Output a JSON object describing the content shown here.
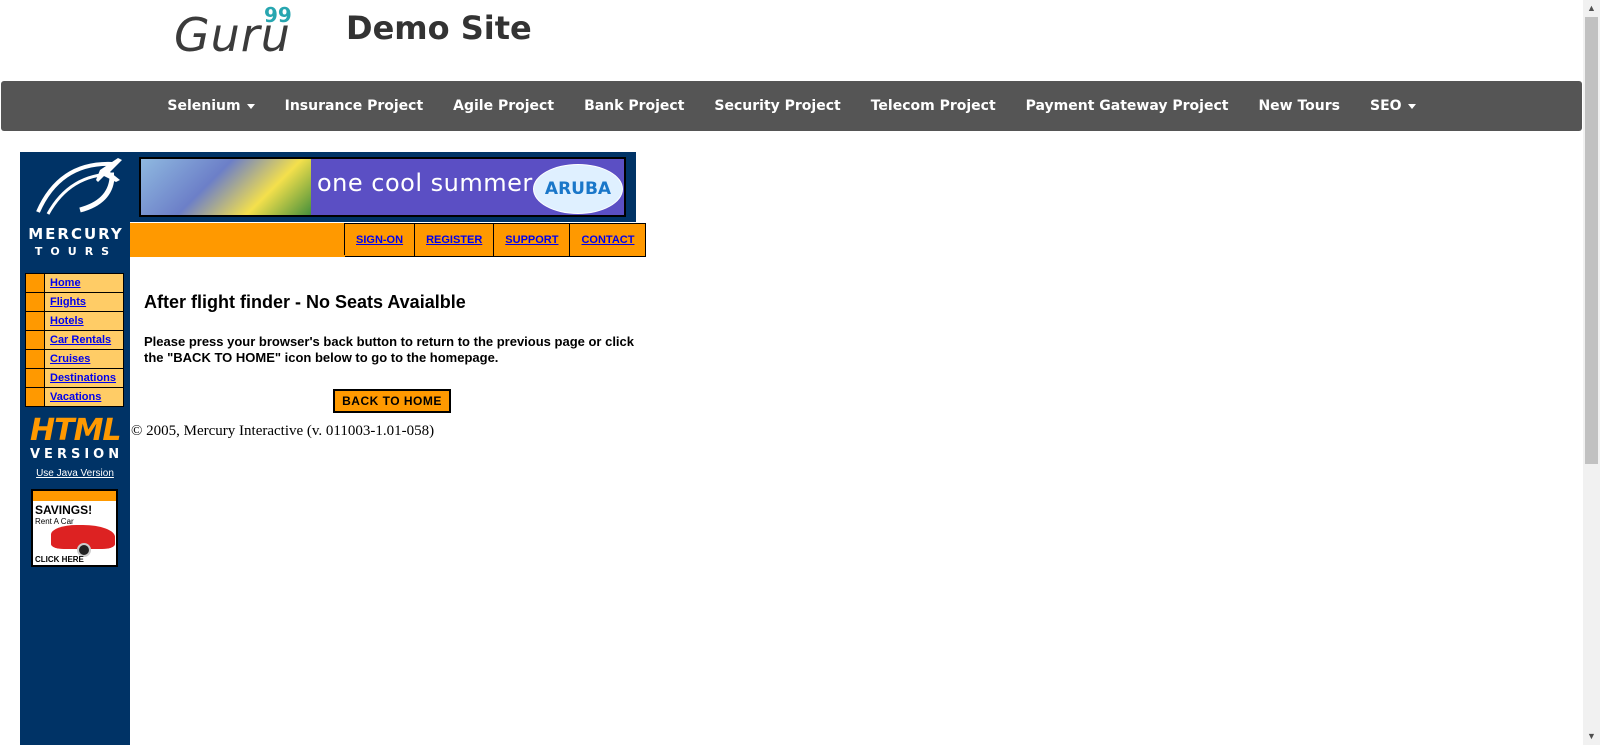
{
  "header": {
    "logo": "Guru",
    "logo_superscript": "99",
    "site_title": "Demo Site"
  },
  "navbar": {
    "items": [
      {
        "label": "Selenium",
        "dropdown": true
      },
      {
        "label": "Insurance Project",
        "dropdown": false
      },
      {
        "label": "Agile Project",
        "dropdown": false
      },
      {
        "label": "Bank Project",
        "dropdown": false
      },
      {
        "label": "Security Project",
        "dropdown": false
      },
      {
        "label": "Telecom Project",
        "dropdown": false
      },
      {
        "label": "Payment Gateway Project",
        "dropdown": false
      },
      {
        "label": "New Tours",
        "dropdown": false
      },
      {
        "label": "SEO",
        "dropdown": true
      }
    ]
  },
  "mercury": {
    "logo_line1": "MERCURY",
    "logo_line2": "TOURS",
    "banner_text": "one cool summer",
    "banner_brand": "ARUBA",
    "top_links": [
      "SIGN-ON",
      "REGISTER",
      "SUPPORT",
      "CONTACT"
    ],
    "left_nav": [
      "Home",
      "Flights",
      "Hotels",
      "Car Rentals",
      "Cruises",
      "Destinations",
      "Vacations"
    ],
    "html_version_big": "HTML",
    "html_version_small": "VERSION",
    "java_link": "Use Java Version",
    "ad": {
      "title": "SAVINGS!",
      "subtitle": "Rent A Car",
      "cta": "CLICK HERE"
    }
  },
  "main": {
    "heading": "After flight finder - No Seats Avaialble",
    "message": "Please press your browser's back button to return to the previous page or click the \"BACK TO HOME\" icon below to go to the homepage.",
    "back_button": "BACK TO HOME",
    "copyright": "© 2005, Mercury Interactive (v. 011003-1.01-058)"
  },
  "colors": {
    "navbar_bg": "#555555",
    "mercury_blue": "#003366",
    "mercury_orange": "#ff9900",
    "nav_link_bg": "#ffcc66",
    "banner_purple": "#5b4fc4"
  }
}
